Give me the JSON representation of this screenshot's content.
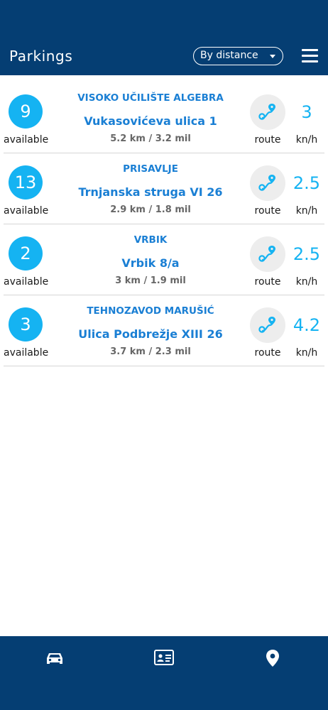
{
  "header": {
    "title": "Parkings",
    "sort_label": "By distance",
    "menu_icon": "hamburger-menu-icon"
  },
  "parkings": [
    {
      "available": "9",
      "available_label": "available",
      "name": "VISOKO UČILIŠTE ALGEBRA",
      "address": "Vukasovićeva ulica 1",
      "distance": "5.2 km / 3.2 mil",
      "route_label": "route",
      "speed": "3",
      "speed_unit": "kn/h"
    },
    {
      "available": "13",
      "available_label": "available",
      "name": "PRISAVLJE",
      "address": "Trnjanska struga VI 26",
      "distance": "2.9 km / 1.8 mil",
      "route_label": "route",
      "speed": "2.5",
      "speed_unit": "kn/h"
    },
    {
      "available": "2",
      "available_label": "available",
      "name": "VRBIK",
      "address": "Vrbik 8/a",
      "distance": "3 km / 1.9 mil",
      "route_label": "route",
      "speed": "2.5",
      "speed_unit": "kn/h"
    },
    {
      "available": "3",
      "available_label": "available",
      "name": "TEHNOZAVOD MARUŠIĆ",
      "address": "Ulica Podbrežje XIII 26",
      "distance": "3.7 km / 2.3 mil",
      "route_label": "route",
      "speed": "4.2",
      "speed_unit": "kn/h"
    }
  ],
  "bottom_nav": {
    "items": [
      {
        "icon": "car-icon"
      },
      {
        "icon": "id-card-icon"
      },
      {
        "icon": "map-pin-icon"
      }
    ]
  },
  "colors": {
    "primary_dark": "#053e73",
    "accent": "#15b3f2",
    "link": "#1a7fd4"
  }
}
